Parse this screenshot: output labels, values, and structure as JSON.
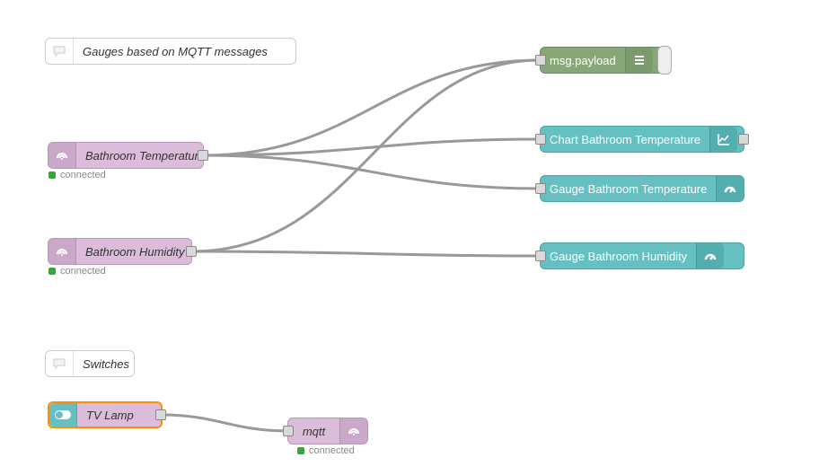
{
  "comments": {
    "c1": "Gauges based on MQTT messages",
    "c2": "Switches"
  },
  "nodes": {
    "mqtt_in_temp": {
      "label": "Bathroom Temperature",
      "status": "connected"
    },
    "mqtt_in_hum": {
      "label": "Bathroom Humidity",
      "status": "connected"
    },
    "debug": {
      "label": "msg.payload"
    },
    "ui_chart_temp": {
      "label": "Chart Bathroom Temperature"
    },
    "ui_gauge_temp": {
      "label": "Gauge Bathroom Temperature"
    },
    "ui_gauge_hum": {
      "label": "Gauge Bathroom Humidity"
    },
    "ui_switch": {
      "label": "TV Lamp"
    },
    "mqtt_out": {
      "label": "mqtt",
      "status": "connected"
    }
  },
  "colors": {
    "mqtt": "#dbbddb",
    "debug": "#87a779",
    "ui": "#66c0c2",
    "selected_border": "#ff8f00",
    "status_ok": "#3aa33a"
  },
  "chart_data": {
    "type": "node-graph",
    "nodes": [
      {
        "id": "c1",
        "kind": "comment"
      },
      {
        "id": "c2",
        "kind": "comment"
      },
      {
        "id": "mqtt_in_temp",
        "kind": "mqtt-in"
      },
      {
        "id": "mqtt_in_hum",
        "kind": "mqtt-in"
      },
      {
        "id": "debug",
        "kind": "debug"
      },
      {
        "id": "ui_chart_temp",
        "kind": "ui-chart"
      },
      {
        "id": "ui_gauge_temp",
        "kind": "ui-gauge"
      },
      {
        "id": "ui_gauge_hum",
        "kind": "ui-gauge"
      },
      {
        "id": "ui_switch",
        "kind": "ui-switch"
      },
      {
        "id": "mqtt_out",
        "kind": "mqtt-out"
      }
    ],
    "edges": [
      {
        "from": "mqtt_in_temp",
        "to": "debug"
      },
      {
        "from": "mqtt_in_temp",
        "to": "ui_chart_temp"
      },
      {
        "from": "mqtt_in_temp",
        "to": "ui_gauge_temp"
      },
      {
        "from": "mqtt_in_hum",
        "to": "debug"
      },
      {
        "from": "mqtt_in_hum",
        "to": "ui_gauge_hum"
      },
      {
        "from": "ui_switch",
        "to": "mqtt_out"
      }
    ]
  }
}
